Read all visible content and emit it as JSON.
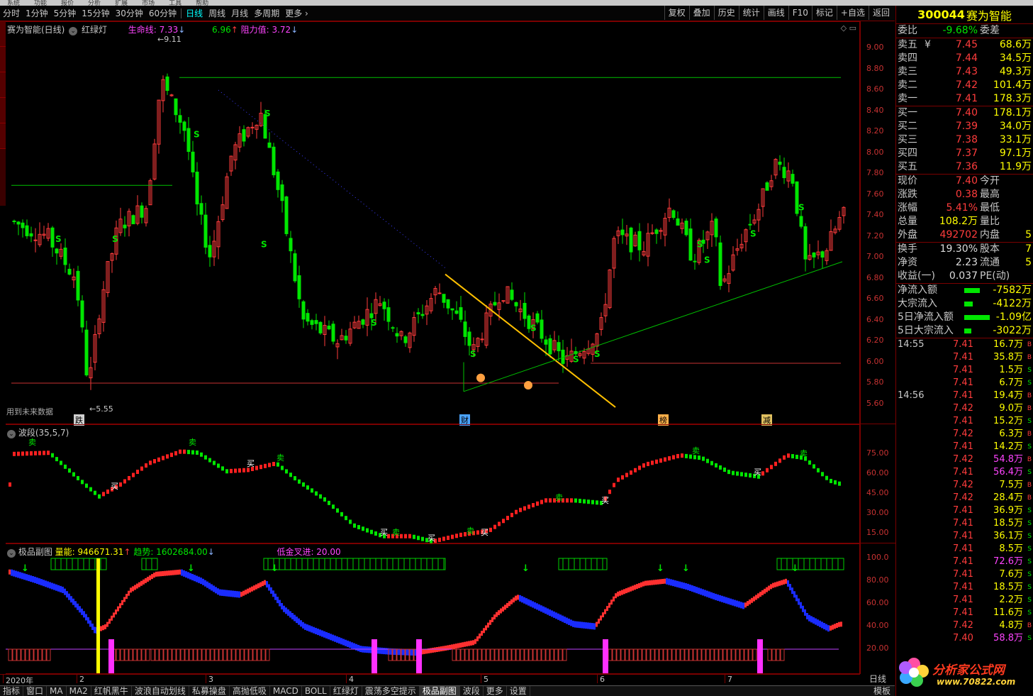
{
  "top_menu": [
    "系统",
    "功能",
    "报价",
    "分析",
    "扩展",
    "市场",
    "工具",
    "帮助"
  ],
  "toolbar": {
    "timeframes": [
      "分时",
      "1分钟",
      "5分钟",
      "15分钟",
      "30分钟",
      "60分钟",
      "日线",
      "周线",
      "月线",
      "多周期",
      "更多 ›"
    ],
    "active": "日线",
    "right_buttons": [
      "复权",
      "叠加",
      "历史",
      "统计",
      "画线",
      "F10",
      "标记",
      "+自选",
      "返回"
    ]
  },
  "main_header": {
    "stock": "赛为智能(日线)",
    "indicator": "红绿灯",
    "life_line_label": "生命线: ",
    "life_line_value": "7.33",
    "life_line_arrow": "↓",
    "support_value": "6.96",
    "support_arrow": "↑",
    "resistance_label": "阻力值: ",
    "resistance_value": "3.72",
    "resistance_arrow": "↓",
    "high_label": "9.11",
    "low_label": "5.55",
    "future_note": "用到未来数据",
    "markers": [
      "跌",
      "财",
      "榜",
      "减"
    ]
  },
  "main_axis": [
    "9.00",
    "8.80",
    "8.60",
    "8.40",
    "8.20",
    "8.00",
    "7.80",
    "7.60",
    "7.40",
    "7.20",
    "7.00",
    "6.80",
    "6.60",
    "6.40",
    "6.20",
    "6.00",
    "5.80",
    "5.60"
  ],
  "wave_panel": {
    "title": "波段(35,5,7)",
    "axis": [
      "75.00",
      "60.00",
      "45.00",
      "30.00",
      "15.00"
    ],
    "buy": "买",
    "sell": "卖"
  },
  "jp_panel": {
    "title": "极品副图",
    "energy_label": "量能: ",
    "energy_value": "946671.31",
    "energy_arrow": "↑",
    "trend_label": "趋势: ",
    "trend_value": "1602684.00",
    "trend_arrow": "↓",
    "cross_label": "低金叉进: ",
    "cross_value": "20.00",
    "axis": [
      "100.0",
      "80.00",
      "60.00",
      "40.00",
      "20.00"
    ]
  },
  "date_axis": [
    "2020年",
    "2",
    "3",
    "4",
    "5",
    "6",
    "7"
  ],
  "period_button": "日线",
  "bottom_tabs": [
    "指标",
    "窗口",
    "MA",
    "MA2",
    "红帆黑牛",
    "波浪自动划线",
    "私募操盘",
    "高抛低吸",
    "MACD",
    "BOLL",
    "红绿灯",
    "震荡多空提示",
    "极品副图",
    "波段",
    "更多",
    "设置"
  ],
  "bottom_active": "极品副图",
  "bottom_right": "模板",
  "quote": {
    "code": "300044",
    "name": "赛为智能",
    "ratio_label": "委比",
    "ratio_value": "-9.68%",
    "diff_label": "委差",
    "asks": [
      {
        "label": "卖五",
        "price": "7.45",
        "vol": "68.6万"
      },
      {
        "label": "卖四",
        "price": "7.44",
        "vol": "34.5万"
      },
      {
        "label": "卖三",
        "price": "7.43",
        "vol": "49.3万"
      },
      {
        "label": "卖二",
        "price": "7.42",
        "vol": "101.4万"
      },
      {
        "label": "卖一",
        "price": "7.41",
        "vol": "178.3万"
      }
    ],
    "ask_extra": "¥",
    "bids": [
      {
        "label": "买一",
        "price": "7.40",
        "vol": "178.1万"
      },
      {
        "label": "买二",
        "price": "7.39",
        "vol": "34.0万"
      },
      {
        "label": "买三",
        "price": "7.38",
        "vol": "33.1万"
      },
      {
        "label": "买四",
        "price": "7.37",
        "vol": "97.1万"
      },
      {
        "label": "买五",
        "price": "7.36",
        "vol": "11.9万"
      }
    ],
    "stats": [
      {
        "l": "现价",
        "v": "7.40",
        "r": "今开",
        "rv": ""
      },
      {
        "l": "涨跌",
        "v": "0.38",
        "r": "最高",
        "rv": ""
      },
      {
        "l": "涨幅",
        "v": "5.41%",
        "r": "最低",
        "rv": ""
      },
      {
        "l": "总量",
        "v": "108.2万",
        "r": "量比",
        "rv": ""
      },
      {
        "l": "外盘",
        "v": "492702",
        "r": "内盘",
        "rv": "5"
      }
    ],
    "stats2": [
      {
        "l": "换手",
        "v": "19.30%",
        "r": "股本",
        "rv": "7"
      },
      {
        "l": "净资",
        "v": "2.23",
        "r": "流通",
        "rv": "5"
      },
      {
        "l": "收益(一)",
        "v": "0.037",
        "r": "PE(动)",
        "rv": ""
      }
    ],
    "flows": [
      {
        "l": "净流入额",
        "v": "-7582万",
        "w": 22
      },
      {
        "l": "大宗流入",
        "v": "-4122万",
        "w": 12
      },
      {
        "l": "5日净流入额",
        "v": "-1.09亿",
        "w": 36
      },
      {
        "l": "5日大宗流入",
        "v": "-3022万",
        "w": 10
      }
    ],
    "ticks": [
      {
        "t": "14:55",
        "p": "7.41",
        "v": "16.7万",
        "c": "yellow",
        "d": "B"
      },
      {
        "t": "",
        "p": "7.41",
        "v": "35.8万",
        "c": "yellow",
        "d": "B"
      },
      {
        "t": "",
        "p": "7.41",
        "v": "1.5万",
        "c": "yellow",
        "d": "S"
      },
      {
        "t": "",
        "p": "7.41",
        "v": "6.7万",
        "c": "yellow",
        "d": "S"
      },
      {
        "t": "14:56",
        "p": "7.41",
        "v": "19.4万",
        "c": "yellow",
        "d": "B"
      },
      {
        "t": "",
        "p": "7.42",
        "v": "9.0万",
        "c": "yellow",
        "d": "B"
      },
      {
        "t": "",
        "p": "7.41",
        "v": "15.2万",
        "c": "yellow",
        "d": "S"
      },
      {
        "t": "",
        "p": "7.42",
        "v": "6.3万",
        "c": "yellow",
        "d": "B"
      },
      {
        "t": "",
        "p": "7.41",
        "v": "14.2万",
        "c": "yellow",
        "d": "S"
      },
      {
        "t": "",
        "p": "7.42",
        "v": "54.8万",
        "c": "magenta",
        "d": "B"
      },
      {
        "t": "",
        "p": "7.41",
        "v": "56.4万",
        "c": "magenta",
        "d": "S"
      },
      {
        "t": "",
        "p": "7.42",
        "v": "7.5万",
        "c": "yellow",
        "d": "B"
      },
      {
        "t": "",
        "p": "7.42",
        "v": "28.4万",
        "c": "yellow",
        "d": "B"
      },
      {
        "t": "",
        "p": "7.41",
        "v": "36.9万",
        "c": "yellow",
        "d": "S"
      },
      {
        "t": "",
        "p": "7.41",
        "v": "18.5万",
        "c": "yellow",
        "d": "S"
      },
      {
        "t": "",
        "p": "7.41",
        "v": "36.1万",
        "c": "yellow",
        "d": "S"
      },
      {
        "t": "",
        "p": "7.41",
        "v": "8.5万",
        "c": "yellow",
        "d": "S"
      },
      {
        "t": "",
        "p": "7.41",
        "v": "72.6万",
        "c": "magenta",
        "d": "S"
      },
      {
        "t": "",
        "p": "7.41",
        "v": "7.6万",
        "c": "yellow",
        "d": "S"
      },
      {
        "t": "",
        "p": "7.41",
        "v": "18.5万",
        "c": "yellow",
        "d": "S"
      },
      {
        "t": "",
        "p": "7.41",
        "v": "2.2万",
        "c": "yellow",
        "d": "S"
      },
      {
        "t": "",
        "p": "7.41",
        "v": "11.6万",
        "c": "yellow",
        "d": "S"
      },
      {
        "t": "",
        "p": "7.42",
        "v": "4.8万",
        "c": "yellow",
        "d": "B"
      },
      {
        "t": "",
        "p": "7.40",
        "v": "58.8万",
        "c": "magenta",
        "d": "S"
      }
    ]
  },
  "watermark": {
    "line1": "分析家公式网",
    "line2": "www.70822.com"
  },
  "colors": {
    "up": "#ff3c3c",
    "down": "#00e600",
    "frame": "#7a0000",
    "yellow": "#ffff00",
    "blue": "#1a2cff",
    "magenta": "#ff44ff"
  }
}
